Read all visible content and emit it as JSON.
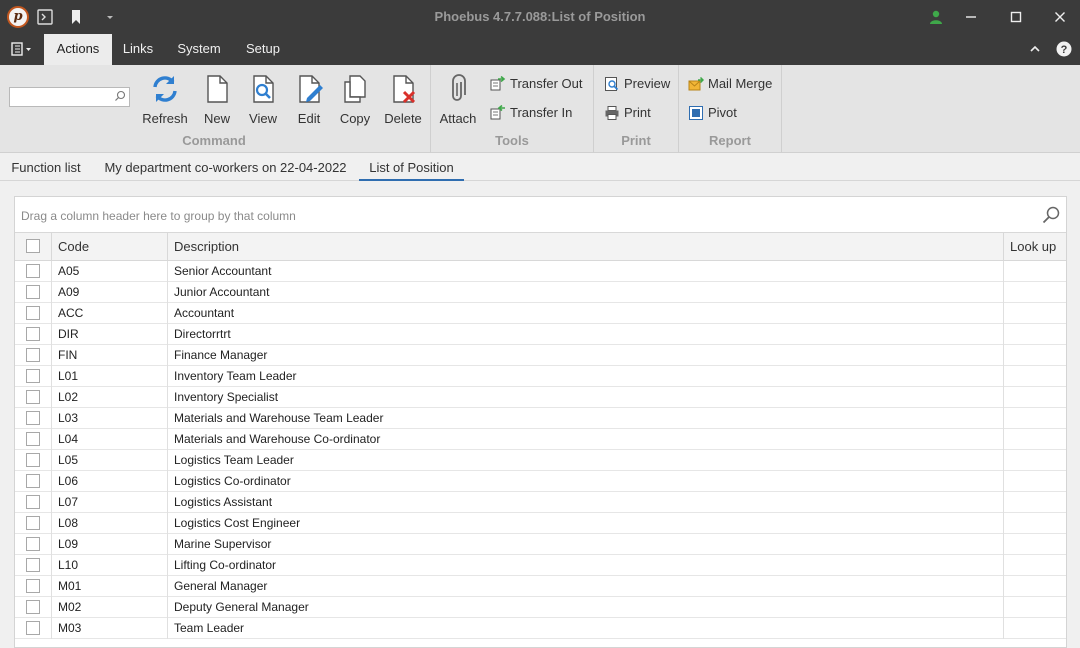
{
  "window": {
    "title": "Phoebus 4.7.7.088:List of Position"
  },
  "menubar": {
    "tabs": [
      {
        "label": "Actions",
        "active": true
      },
      {
        "label": "Links",
        "active": false
      },
      {
        "label": "System",
        "active": false
      },
      {
        "label": "Setup",
        "active": false
      }
    ]
  },
  "ribbon": {
    "search": {
      "value": "",
      "placeholder": ""
    },
    "command": {
      "group_label": "Command",
      "refresh": "Refresh",
      "new": "New",
      "view": "View",
      "edit": "Edit",
      "copy": "Copy",
      "delete": "Delete"
    },
    "tools": {
      "group_label": "Tools",
      "attach": "Attach",
      "transfer_out": "Transfer Out",
      "transfer_in": "Transfer In"
    },
    "print": {
      "group_label": "Print",
      "preview": "Preview",
      "print": "Print"
    },
    "report": {
      "group_label": "Report",
      "mail_merge": "Mail Merge",
      "pivot": "Pivot"
    }
  },
  "doc_tabs": [
    {
      "label": "Function list",
      "active": false
    },
    {
      "label": "My department co-workers on 22-04-2022",
      "active": false
    },
    {
      "label": "List of Position",
      "active": true
    }
  ],
  "grid": {
    "group_panel_hint": "Drag a column header here to group by that column",
    "columns": {
      "code": "Code",
      "description": "Description",
      "lookup": "Look up"
    },
    "rows": [
      {
        "code": "A05",
        "description": "Senior Accountant",
        "lookup": ""
      },
      {
        "code": "A09",
        "description": "Junior Accountant",
        "lookup": ""
      },
      {
        "code": "ACC",
        "description": "Accountant",
        "lookup": ""
      },
      {
        "code": "DIR",
        "description": "Directorrtrt",
        "lookup": ""
      },
      {
        "code": "FIN",
        "description": "Finance Manager",
        "lookup": ""
      },
      {
        "code": "L01",
        "description": "Inventory Team Leader",
        "lookup": ""
      },
      {
        "code": "L02",
        "description": "Inventory Specialist",
        "lookup": ""
      },
      {
        "code": "L03",
        "description": "Materials and Warehouse Team Leader",
        "lookup": ""
      },
      {
        "code": "L04",
        "description": "Materials and Warehouse Co-ordinator",
        "lookup": ""
      },
      {
        "code": "L05",
        "description": "Logistics Team Leader",
        "lookup": ""
      },
      {
        "code": "L06",
        "description": "Logistics Co-ordinator",
        "lookup": ""
      },
      {
        "code": "L07",
        "description": "Logistics Assistant",
        "lookup": ""
      },
      {
        "code": "L08",
        "description": "Logistics Cost Engineer",
        "lookup": ""
      },
      {
        "code": "L09",
        "description": "Marine Supervisor",
        "lookup": ""
      },
      {
        "code": "L10",
        "description": "Lifting Co-ordinator",
        "lookup": ""
      },
      {
        "code": "M01",
        "description": "General Manager",
        "lookup": ""
      },
      {
        "code": "M02",
        "description": "Deputy General Manager",
        "lookup": ""
      },
      {
        "code": "M03",
        "description": "Team Leader",
        "lookup": ""
      }
    ]
  },
  "colors": {
    "titlebar_bg": "#3b3b3b",
    "ribbon_bg": "#e4e4e4",
    "accent_blue": "#2f6db0",
    "delete_red": "#d9312b",
    "user_green": "#3fa84a"
  }
}
